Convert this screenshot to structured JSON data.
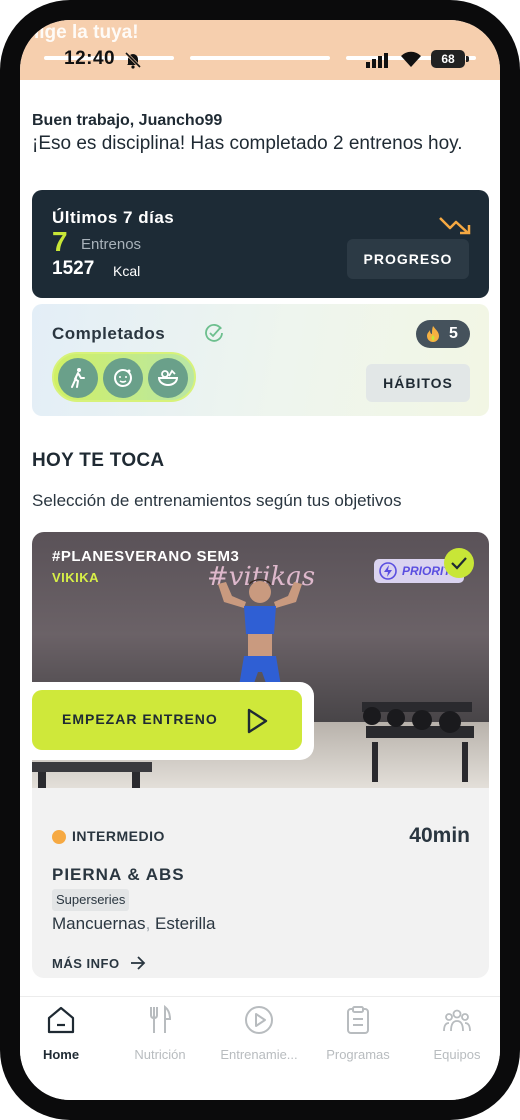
{
  "status_bar": {
    "banner_text": "lige la tuya!",
    "time": "12:40",
    "battery": "68"
  },
  "greeting": {
    "name": "Buen trabajo, Juancho99",
    "message": "¡Eso es disciplina! Has completado 2 entrenos hoy."
  },
  "progress_card": {
    "title": "Últimos 7 días",
    "workouts_count": "7",
    "workouts_label": "Entrenos",
    "kcal_value": "1527",
    "kcal_unit": "Kcal",
    "button_label": "PROGRESO",
    "trend_icon": "trend-down-icon",
    "accent_color": "#c8e637"
  },
  "habits_card": {
    "title": "Completados",
    "streak_count": "5",
    "habits": [
      "walking-icon",
      "skincare-icon",
      "salad-icon"
    ],
    "button_label": "HÁBITOS"
  },
  "section": {
    "title": "HOY TE TOCA",
    "subtitle": "Selección de entrenamientos según tus objetivos"
  },
  "workout": {
    "tag": "#PLANESVERANO SEM3",
    "coach": "VIKIKA",
    "neon_sign": "#vitikas",
    "priority_label": "PRIORITY",
    "start_label": "EMPEZAR ENTRENO",
    "level": "INTERMEDIO",
    "level_color": "#f6a942",
    "duration": "40min",
    "title": "PIERNA & ABS",
    "type_tag": "Superseries",
    "equipment": [
      "Mancuernas",
      "Esterilla"
    ],
    "more_label": "MÁS INFO"
  },
  "tabbar": {
    "tabs": [
      {
        "label": "Home",
        "icon": "home-icon",
        "active": true
      },
      {
        "label": "Nutrición",
        "icon": "cutlery-icon",
        "active": false
      },
      {
        "label": "Entrenamie...",
        "icon": "play-circle-icon",
        "active": false
      },
      {
        "label": "Programas",
        "icon": "clipboard-icon",
        "active": false
      },
      {
        "label": "Equipos",
        "icon": "team-icon",
        "active": false
      }
    ]
  }
}
